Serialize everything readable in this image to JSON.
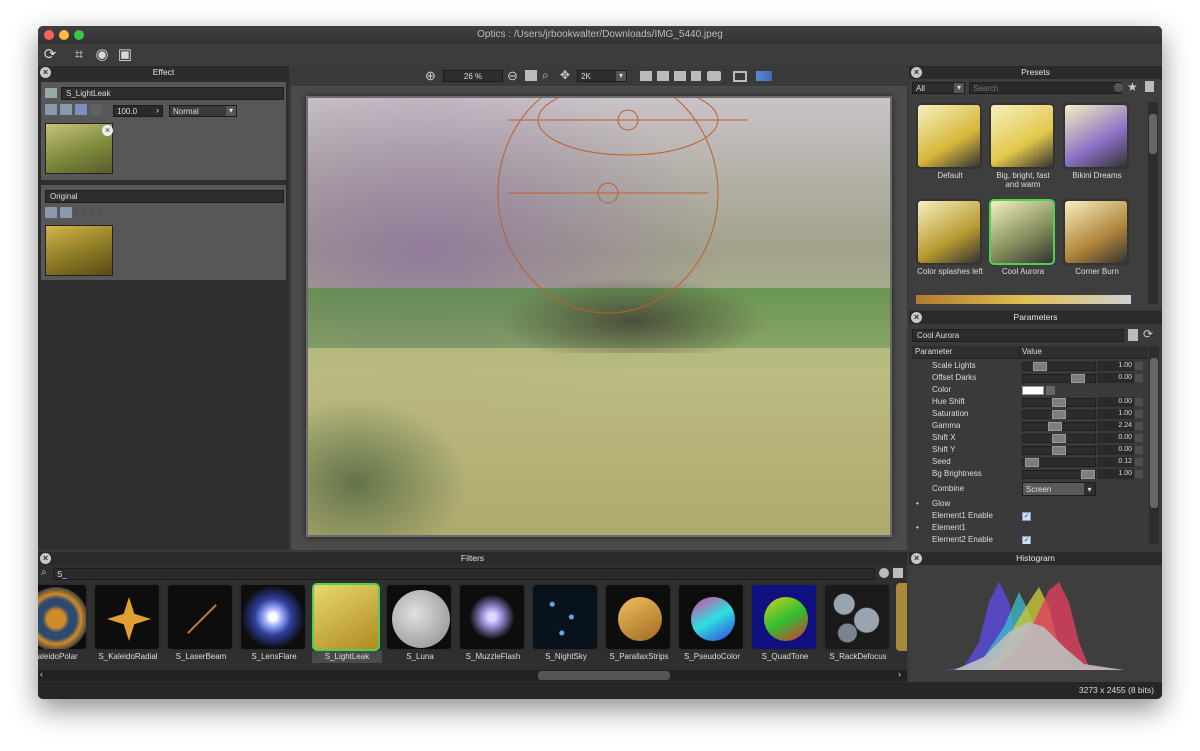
{
  "window": {
    "title": "Optics : /Users/jrbookwalter/Downloads/IMG_5440.jpeg"
  },
  "toolbar": {
    "icons": [
      "reset-icon",
      "crop-icon",
      "mask-icon",
      "frame-icon"
    ]
  },
  "effect_panel": {
    "title": "Effect",
    "layer_name": "S_LightLeak",
    "opacity": "100.0",
    "blend_mode": "Normal",
    "original_label": "Original"
  },
  "viewer": {
    "zoom": "26 %",
    "resolution": "2K"
  },
  "presets": {
    "title": "Presets",
    "filter_value": "All",
    "search_placeholder": "Search",
    "items": [
      {
        "label": "Default",
        "color": "#d6b73a"
      },
      {
        "label": "Big, bright, fast and warm",
        "color": "#e2c84a"
      },
      {
        "label": "Bikini Dreams",
        "color": "#8a6fc4"
      },
      {
        "label": "Color splashes left",
        "color": "#b89a30"
      },
      {
        "label": "Cool Aurora",
        "color": "#7f8a5a"
      },
      {
        "label": "Corner Burn",
        "color": "#b0843a"
      }
    ],
    "selected": "Cool Aurora"
  },
  "parameters": {
    "title": "Parameters",
    "preset_name": "Cool Aurora",
    "col_parameter": "Parameter",
    "col_value": "Value",
    "rows": [
      {
        "name": "Scale Lights",
        "value": "1.00",
        "level": 0.18
      },
      {
        "name": "Offset Darks",
        "value": "0.00",
        "level": 0.7
      },
      {
        "name": "Color",
        "value": ""
      },
      {
        "name": "Hue Shift",
        "value": "0.00",
        "level": 0.45
      },
      {
        "name": "Saturation",
        "value": "1.00",
        "level": 0.45
      },
      {
        "name": "Gamma",
        "value": "2.24",
        "level": 0.4
      },
      {
        "name": "Shift X",
        "value": "0.00",
        "level": 0.45
      },
      {
        "name": "Shift Y",
        "value": "0.00",
        "level": 0.45
      },
      {
        "name": "Seed",
        "value": "0.12",
        "level": 0.05
      },
      {
        "name": "Bg Brightness",
        "value": "1.00",
        "level": 0.85
      }
    ],
    "combine_label": "Combine",
    "combine_value": "Screen",
    "groups": [
      {
        "name": "Glow",
        "bullet": true
      },
      {
        "name": "Element1 Enable",
        "checkbox": true
      },
      {
        "name": "Element1",
        "bullet": true
      },
      {
        "name": "Element2 Enable",
        "checkbox": true
      }
    ]
  },
  "filters": {
    "title": "Filters",
    "search_value": "S_",
    "items": [
      {
        "label": "KaleidoPolar",
        "color": "#d08a2a"
      },
      {
        "label": "S_KaleidoRadial",
        "color": "#e0a030"
      },
      {
        "label": "S_LaserBeam",
        "color": "#c07830"
      },
      {
        "label": "S_LensFlare",
        "color": "#a8b8ff"
      },
      {
        "label": "S_LightLeak",
        "color": "#d8c050"
      },
      {
        "label": "S_Luna",
        "color": "#bdbdbd"
      },
      {
        "label": "S_MuzzleFlash",
        "color": "#9c8cd8"
      },
      {
        "label": "S_NightSky",
        "color": "#6aa8d8"
      },
      {
        "label": "S_ParallaxStrips",
        "color": "#e0a848"
      },
      {
        "label": "S_PseudoColor",
        "color": "#e03ca0"
      },
      {
        "label": "S_QuadTone",
        "color": "#d0d020"
      },
      {
        "label": "S_RackDefocus",
        "color": "#9aa4b0"
      }
    ],
    "selected": "S_LightLeak"
  },
  "histogram": {
    "title": "Histogram"
  },
  "status": {
    "dimensions": "3273 x 2455 (8 bits)"
  }
}
